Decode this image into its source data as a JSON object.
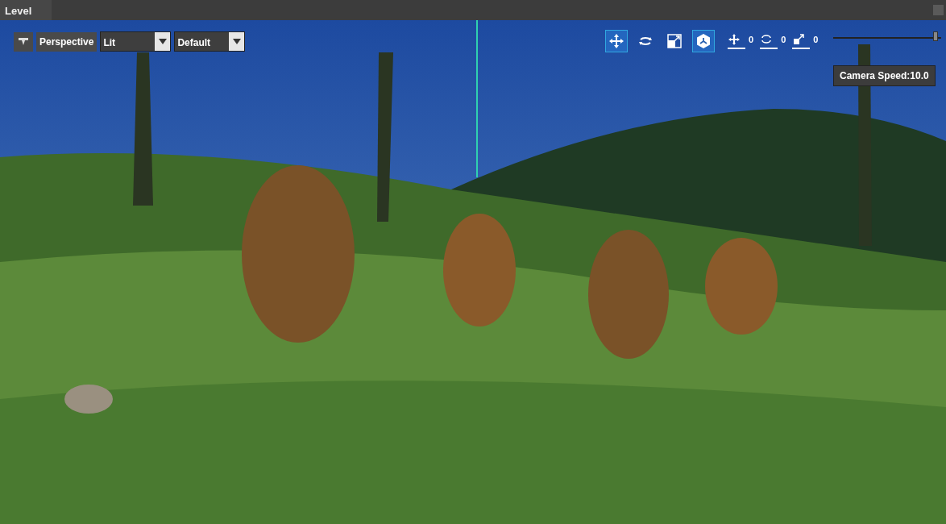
{
  "panel": {
    "title": "Level"
  },
  "viewport": {
    "camera_mode": "Perspective",
    "dropdowns": [
      {
        "value": "Lit"
      },
      {
        "value": "Default"
      }
    ],
    "tools": [
      {
        "kind": "move",
        "selected": true
      },
      {
        "kind": "rotate",
        "selected": false
      },
      {
        "kind": "scale",
        "selected": false
      },
      {
        "kind": "space",
        "selected": true
      }
    ],
    "snaps": [
      {
        "kind": "move",
        "value": "0"
      },
      {
        "kind": "rotate",
        "value": "0"
      },
      {
        "kind": "scale",
        "value": "0"
      }
    ],
    "camera_speed": {
      "level": 0.97,
      "tooltip": "Camera Speed:10.0"
    }
  }
}
